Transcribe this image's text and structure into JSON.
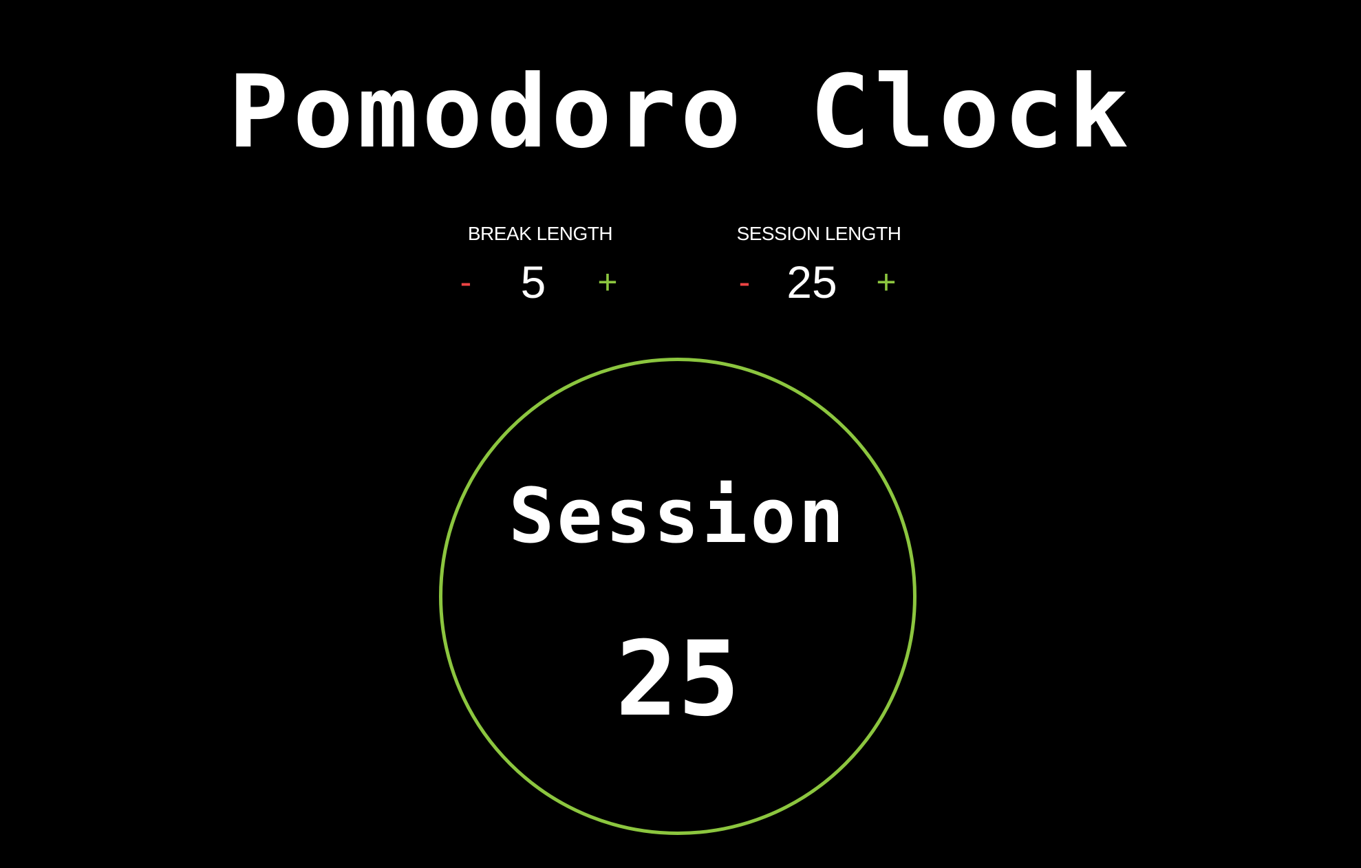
{
  "app": {
    "title": "Pomodoro Clock"
  },
  "break_control": {
    "label": "BREAK LENGTH",
    "decrement_label": "-",
    "value": "5",
    "increment_label": "+"
  },
  "session_control": {
    "label": "SESSION LENGTH",
    "decrement_label": "-",
    "value": "25",
    "increment_label": "+"
  },
  "timer": {
    "mode": "Session",
    "value": "25"
  },
  "colors": {
    "background": "#000000",
    "text": "#ffffff",
    "accent_green": "#8cc63f",
    "decrement_red": "#ee4444"
  }
}
